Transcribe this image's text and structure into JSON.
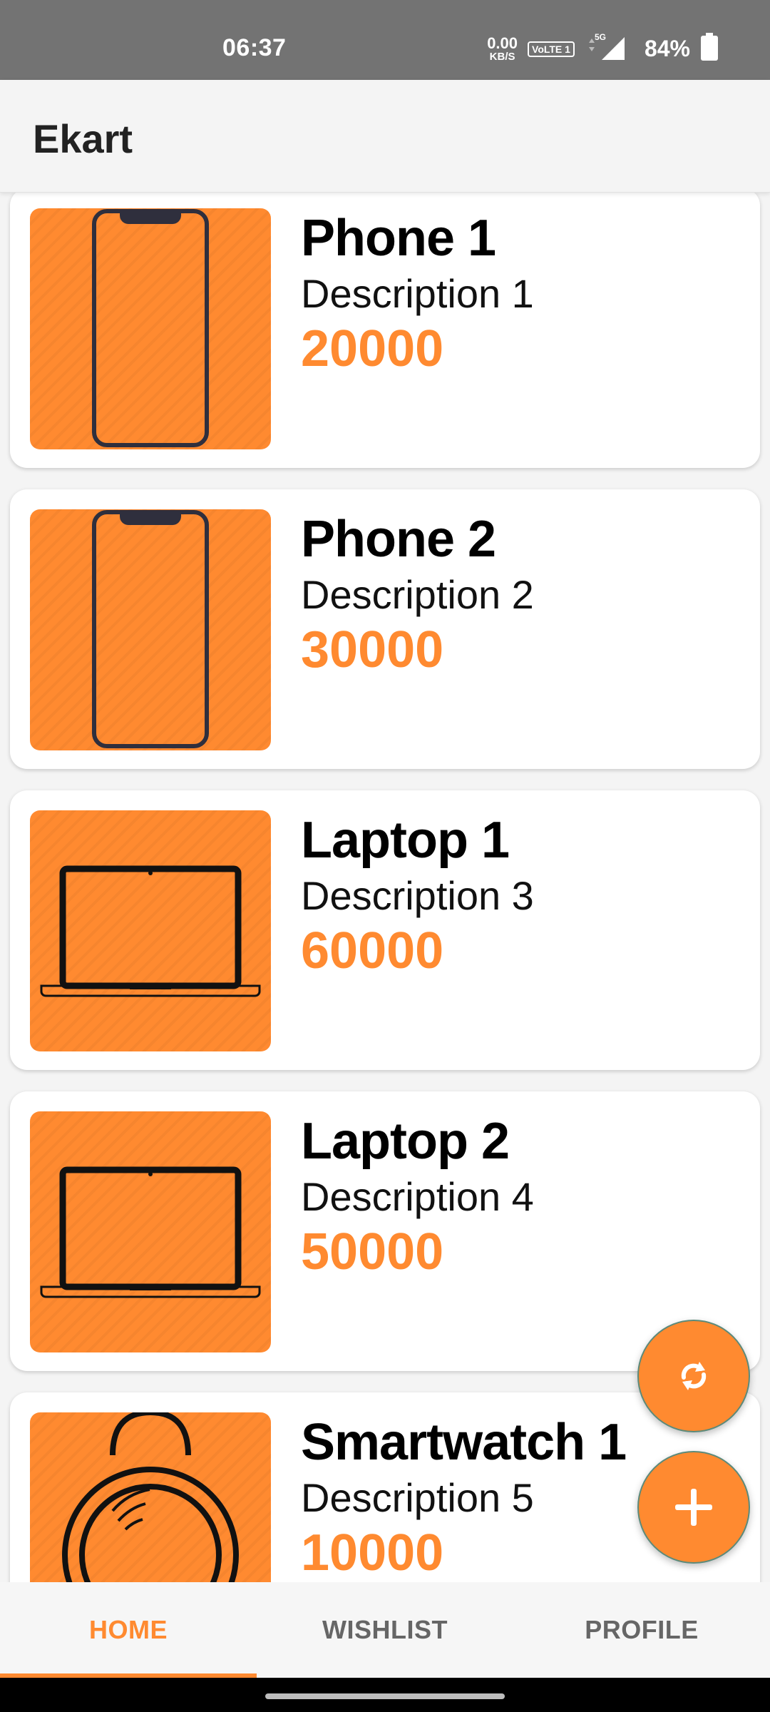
{
  "status_bar": {
    "time": "06:37",
    "net_speed_value": "0.00",
    "net_speed_unit": "KB/S",
    "volte_label": "VoLTE 1",
    "network_label": "5G",
    "battery": "84%"
  },
  "app_bar": {
    "title": "Ekart"
  },
  "products": [
    {
      "name": "Phone 1",
      "description": "Description 1",
      "price": "20000",
      "icon": "phone-icon"
    },
    {
      "name": "Phone 2",
      "description": "Description 2",
      "price": "30000",
      "icon": "phone-icon"
    },
    {
      "name": "Laptop 1",
      "description": "Description 3",
      "price": "60000",
      "icon": "laptop-icon"
    },
    {
      "name": "Laptop 2",
      "description": "Description 4",
      "price": "50000",
      "icon": "laptop-icon"
    },
    {
      "name": "Smartwatch 1",
      "description": "Description 5",
      "price": "10000",
      "icon": "smartwatch-icon"
    }
  ],
  "fabs": {
    "refresh_icon": "refresh-icon",
    "add_icon": "plus-icon"
  },
  "bottom_nav": {
    "tabs": [
      {
        "label": "HOME",
        "active": true
      },
      {
        "label": "WISHLIST",
        "active": false
      },
      {
        "label": "PROFILE",
        "active": false
      }
    ]
  },
  "colors": {
    "accent": "#ff8a30",
    "status_bar": "#737373",
    "background": "#f4f4f4"
  }
}
